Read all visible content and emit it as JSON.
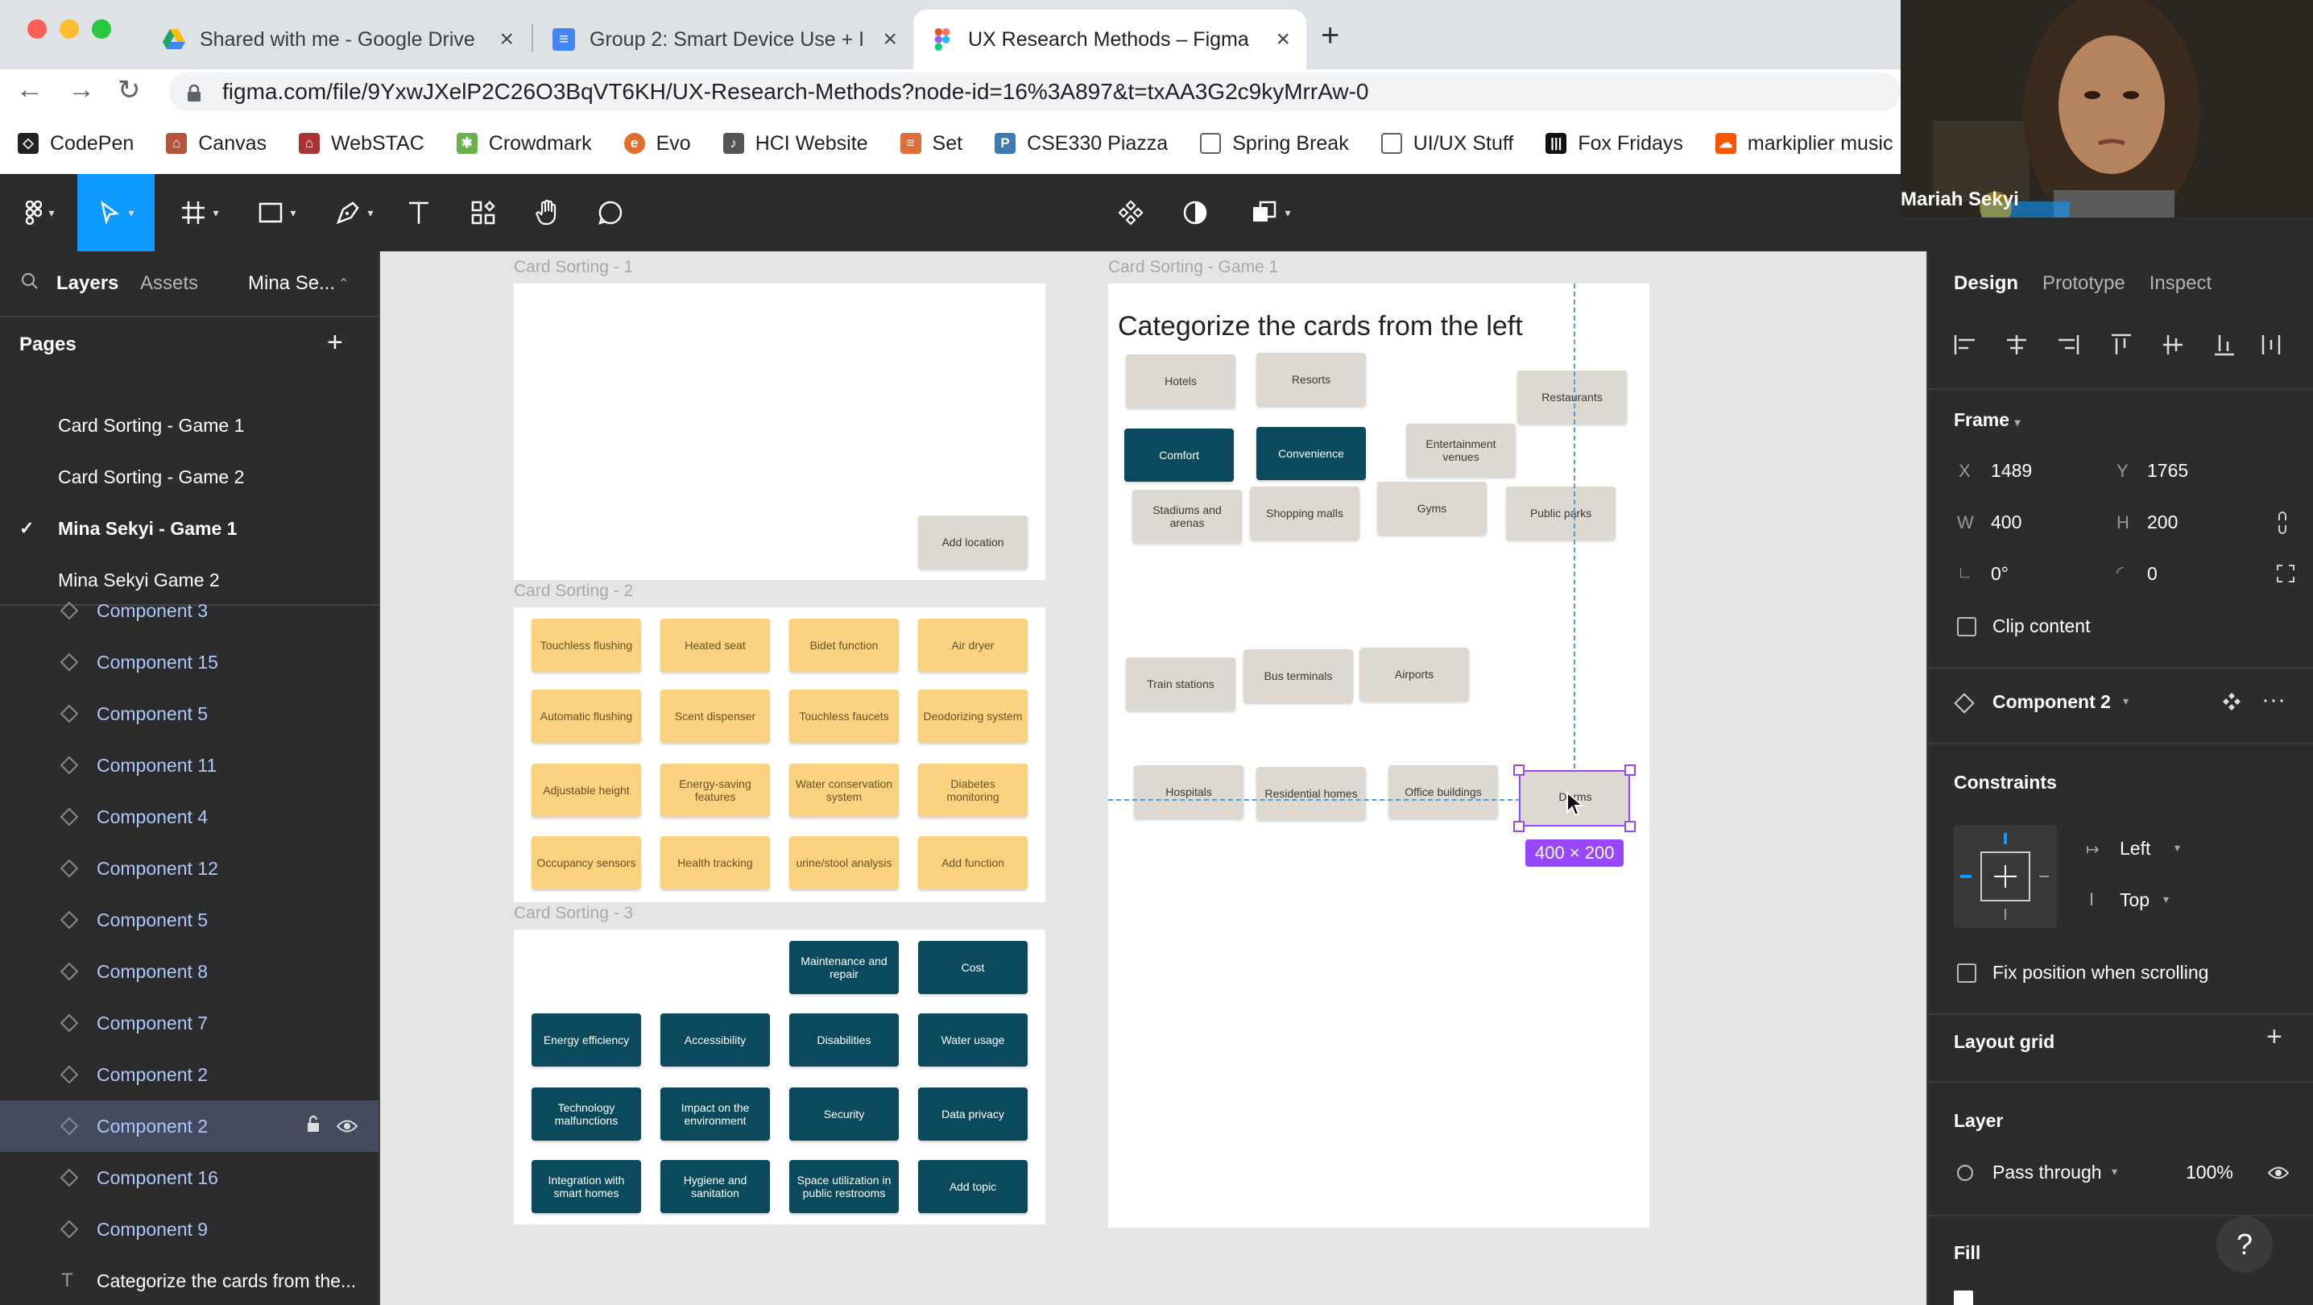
{
  "browser": {
    "tabs": [
      {
        "title": "Shared with me - Google Drive",
        "icon": "google-drive-icon"
      },
      {
        "title": "Group 2: Smart Device Use + I",
        "icon": "google-docs-icon"
      },
      {
        "title": "UX Research Methods – Figma",
        "icon": "figma-icon"
      }
    ],
    "url": "figma.com/file/9YxwJXelP2C26O3BqVT6KH/UX-Research-Methods?node-id=16%3A897&t=txAA3G2c9kyMrrAw-0",
    "bookmarks": [
      "CodePen",
      "Canvas",
      "WebSTAC",
      "Crowdmark",
      "Evo",
      "HCI Website",
      "Set",
      "CSE330 Piazza",
      "Spring Break",
      "UI/UX Stuff",
      "Fox Fridays",
      "markiplier music"
    ]
  },
  "left_panel": {
    "tabs": {
      "layers": "Layers",
      "assets": "Assets",
      "page": "Mina Se..."
    },
    "pages_title": "Pages",
    "pages": [
      "Card Sorting - Game 1",
      "Card Sorting - Game 2",
      "Mina Sekyi - Game 1",
      "Mina Sekyi Game 2"
    ],
    "layers": [
      "Component 3",
      "Component 15",
      "Component 5",
      "Component 11",
      "Component 4",
      "Component 12",
      "Component 5",
      "Component 8",
      "Component 7",
      "Component 2",
      "Component 2",
      "Component 16",
      "Component 9",
      "Categorize the cards from the..."
    ]
  },
  "canvas": {
    "frame_labels": [
      "Card Sorting - 1",
      "Card Sorting - 2",
      "Card Sorting - 3",
      "Card Sorting - Game 1"
    ],
    "title": "Categorize the cards from the left",
    "sorting1_cards": [
      "Add location"
    ],
    "sorting2_cards": [
      "Touchless flushing",
      "Heated seat",
      "Bidet function",
      "Air dryer",
      "Automatic flushing",
      "Scent dispenser",
      "Touchless faucets",
      "Deodorizing system",
      "Adjustable height",
      "Energy-saving features",
      "Water conservation system",
      "Diabetes monitoring",
      "Occupancy sensors",
      "Health tracking",
      "urine/stool analysis",
      "Add function"
    ],
    "sorting3_cards": [
      "Maintenance and repair",
      "Cost",
      "Energy efficiency",
      "Accessibility",
      "Disabilities",
      "Water usage",
      "Technology malfunctions",
      "Impact on the environment",
      "Security",
      "Data privacy",
      "Integration with smart homes",
      "Hygiene and sanitation",
      "Space utilization in public restrooms",
      "Add topic"
    ],
    "game_cards": [
      "Hotels",
      "Resorts",
      "Restaurants",
      "Comfort",
      "Convenience",
      "Entertainment venues",
      "Stadiums and arenas",
      "Shopping malls",
      "Gyms",
      "Public parks",
      "Train stations",
      "Bus terminals",
      "Airports",
      "Hospitals",
      "Residential homes",
      "Office buildings",
      "Dorms"
    ],
    "selection_size": "400 × 200"
  },
  "right_panel": {
    "tabs": {
      "design": "Design",
      "prototype": "Prototype",
      "inspect": "Inspect"
    },
    "frame_label": "Frame",
    "x_label": "X",
    "x": "1489",
    "y_label": "Y",
    "y": "1765",
    "w_label": "W",
    "w": "400",
    "h_label": "H",
    "h": "200",
    "rotation": "0°",
    "radius": "0",
    "clip_content": "Clip content",
    "component": "Component 2",
    "constraints_title": "Constraints",
    "constraint_h": "Left",
    "constraint_v": "Top",
    "fix_position": "Fix position when scrolling",
    "layout_grid": "Layout grid",
    "layer_title": "Layer",
    "blend": "Pass through",
    "opacity": "100%",
    "fill_title": "Fill"
  },
  "webcam": {
    "name": "Mariah Sekyi"
  },
  "colors": {
    "figma_blue": "#0d99ff",
    "selection_purple": "#9747ff",
    "card_yellow": "#fbd27f",
    "card_teal": "#0b4a5c",
    "card_grey": "#ddd8d0"
  }
}
